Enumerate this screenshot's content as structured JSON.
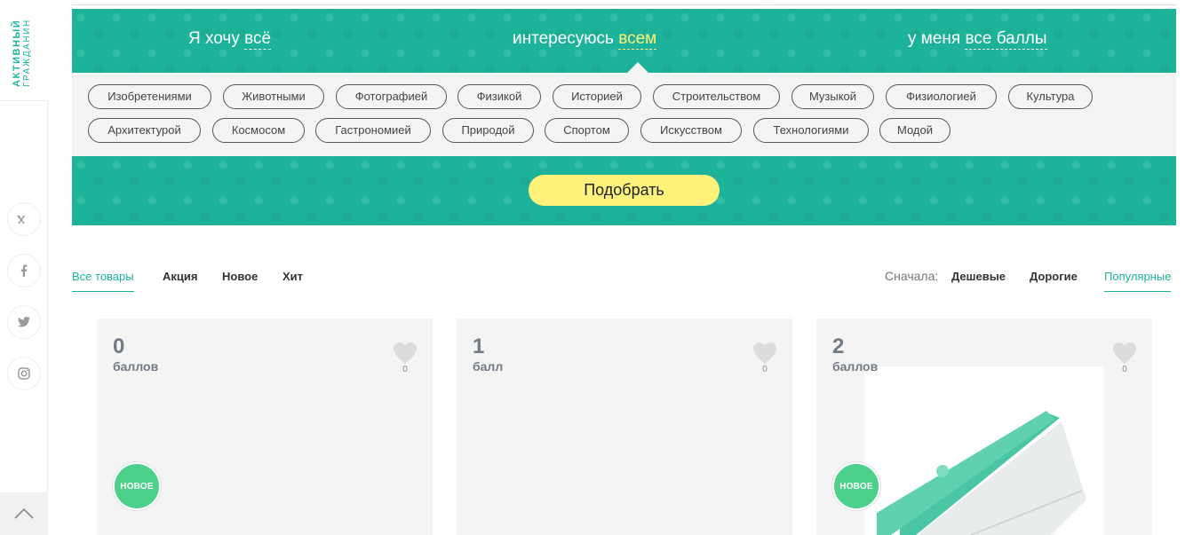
{
  "brand": {
    "line1": "Активный",
    "line2": "гражданин"
  },
  "social": [
    "vk-icon",
    "facebook-icon",
    "twitter-icon",
    "instagram-icon"
  ],
  "sentence": {
    "want_prefix": "Я хочу ",
    "want_value": "всё",
    "interest_prefix": "интересуюсь ",
    "interest_value": "всем",
    "points_prefix": "у меня ",
    "points_value": "все баллы"
  },
  "tags_row1": [
    "Изобретениями",
    "Животными",
    "Фотографией",
    "Физикой",
    "Историей",
    "Строительством",
    "Музыкой",
    "Физиологией",
    "Культура"
  ],
  "tags_row2": [
    "Архитектурой",
    "Космосом",
    "Гастрономией",
    "Природой",
    "Спортом",
    "Искусством",
    "Технологиями",
    "Модой"
  ],
  "pick_button": "Подобрать",
  "filters": [
    "Все товары",
    "Акция",
    "Новое",
    "Хит"
  ],
  "sort": {
    "label": "Сначала:",
    "options": [
      "Дешевые",
      "Дорогие",
      "Популярные"
    ]
  },
  "cards": [
    {
      "points": "0",
      "unit": "баллов",
      "likes": "0",
      "badge": "НОВОЕ"
    },
    {
      "points": "1",
      "unit": "балл",
      "likes": "0",
      "badge": ""
    },
    {
      "points": "2",
      "unit": "баллов",
      "likes": "0",
      "badge": "НОВОЕ"
    }
  ],
  "colors": {
    "accent": "#1db39b",
    "highlight": "#fff27a",
    "badge": "#4cd08a"
  }
}
